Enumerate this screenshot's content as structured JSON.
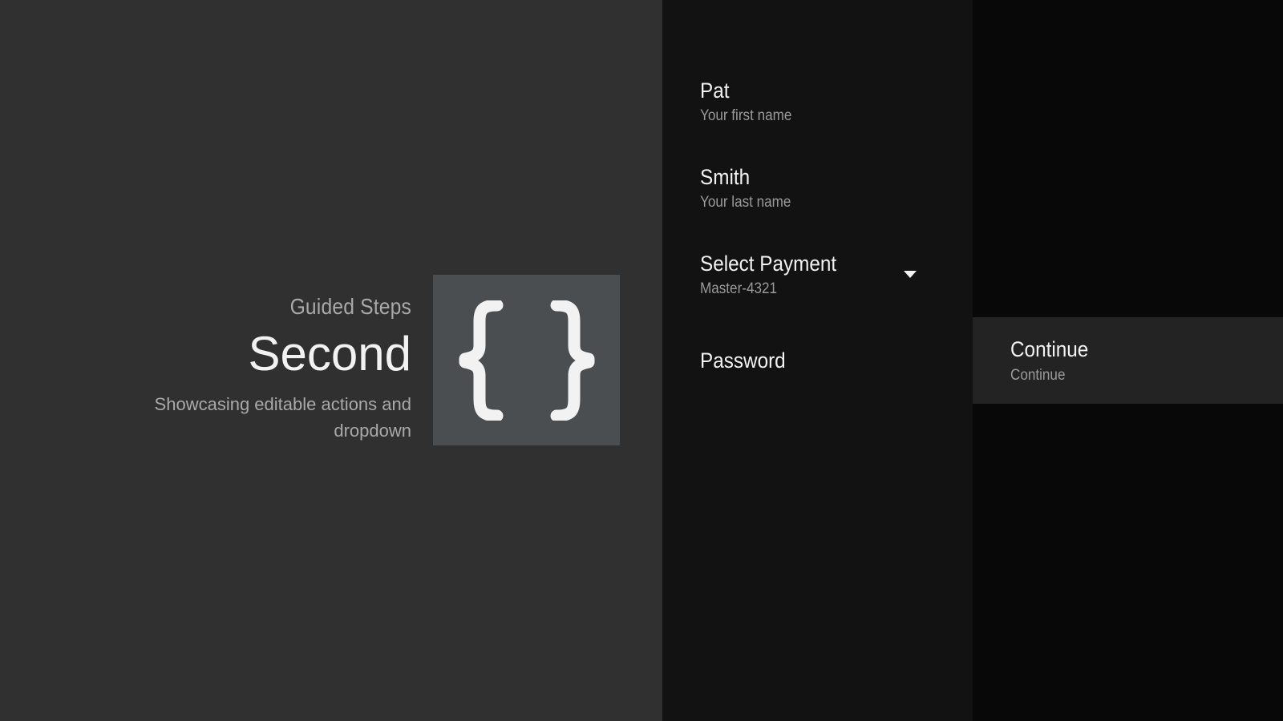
{
  "guidance": {
    "breadcrumb": "Guided Steps",
    "title": "Second",
    "description": "Showcasing editable actions and dropdown",
    "icon": "curly-braces-icon"
  },
  "actions": [
    {
      "title": "Pat",
      "description": "Your first name"
    },
    {
      "title": "Smith",
      "description": "Your last name"
    },
    {
      "title": "Select Payment",
      "description": "Master-4321",
      "dropdown_icon": "dropdown-arrow-icon"
    },
    {
      "title": "Password"
    }
  ],
  "button_actions": [
    {
      "title": "Continue",
      "description": "Continue"
    }
  ],
  "colors": {
    "guidance_bg": "#303030",
    "icon_bg": "#4a4e51",
    "actions_bg": "#121212",
    "button_panel_bg": "#080808",
    "focused_button_bg": "#232323",
    "primary_text": "#f2f2f2",
    "secondary_text": "#9a9a9a"
  }
}
